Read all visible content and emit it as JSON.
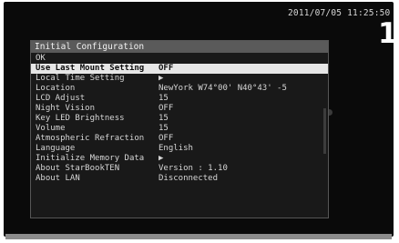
{
  "status": {
    "timestamp": "2011/07/05 11:25:50",
    "page_number": "1"
  },
  "menu": {
    "title": "Initial Configuration",
    "items": [
      {
        "label": "OK",
        "value": ""
      },
      {
        "label": "Use Last Mount Setting",
        "value": "OFF"
      },
      {
        "label": "Local Time Setting",
        "value": "▶"
      },
      {
        "label": "Location",
        "value": "NewYork W74°00' N40°43' -5"
      },
      {
        "label": "LCD Adjust",
        "value": "15"
      },
      {
        "label": "Night Vision",
        "value": "OFF"
      },
      {
        "label": "Key LED Brightness",
        "value": "15"
      },
      {
        "label": "Volume",
        "value": "15"
      },
      {
        "label": "Atmospheric Refraction",
        "value": "OFF"
      },
      {
        "label": "Language",
        "value": "English"
      },
      {
        "label": "Initialize Memory Data",
        "value": "▶"
      },
      {
        "label": "About StarBookTEN",
        "value": "Version : 1.10"
      },
      {
        "label": "About LAN",
        "value": "Disconnected"
      }
    ],
    "selected_index": 1
  },
  "colors": {
    "screen_bg": "#0a0a0a",
    "panel_bg": "#191919",
    "title_bar": "#5a5a5a",
    "selection": "#e6e6e6",
    "text": "#d6d6d6"
  }
}
